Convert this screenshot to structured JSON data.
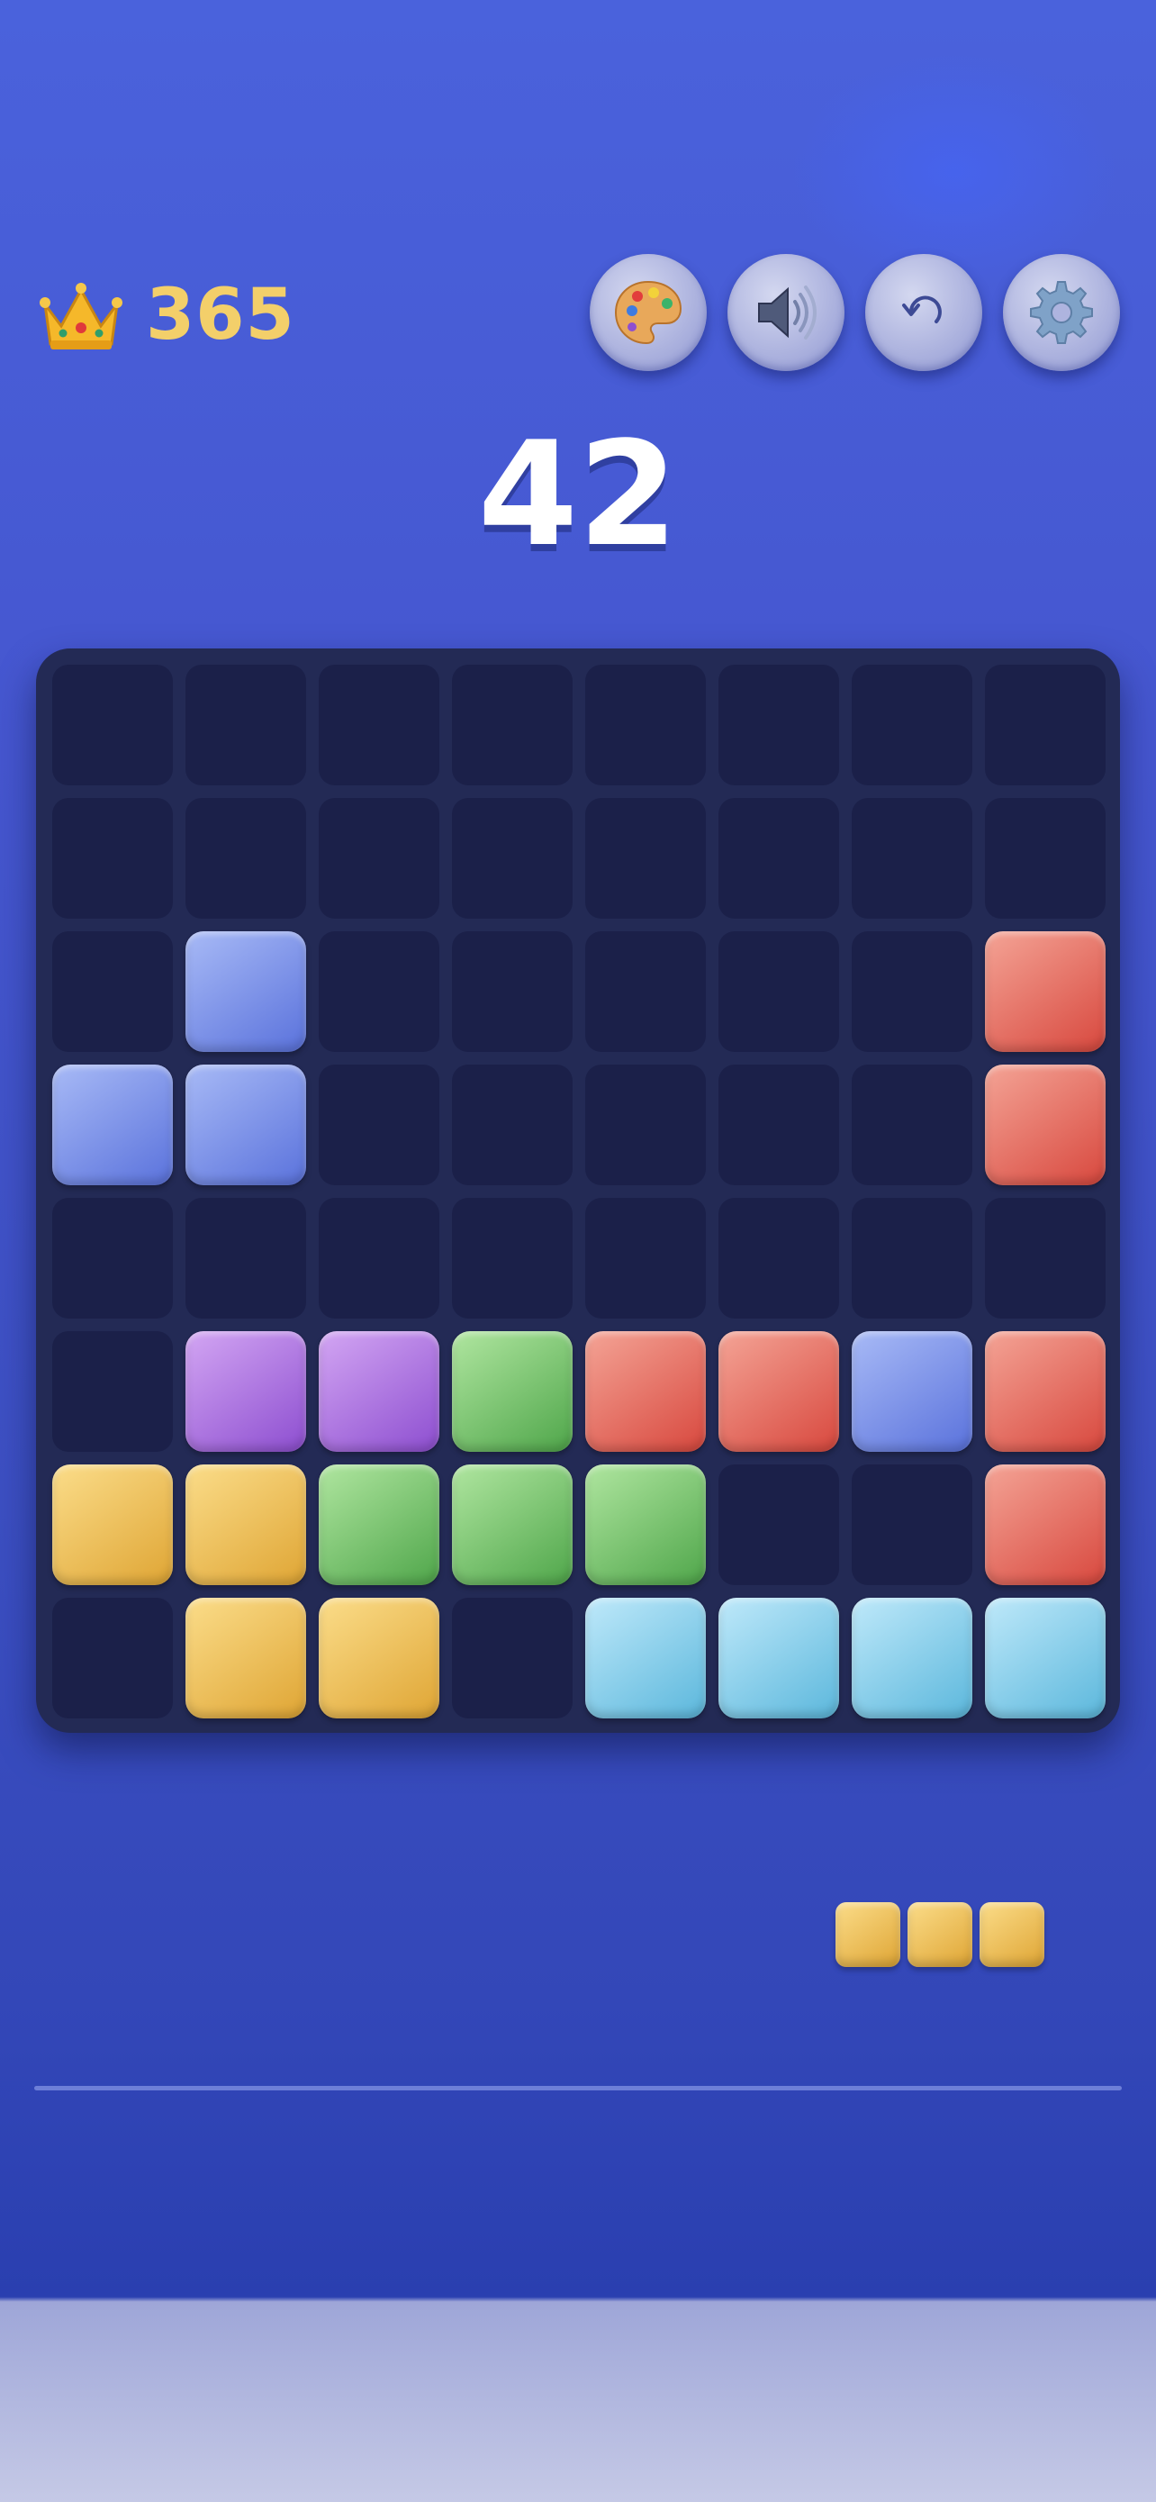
{
  "best_score": {
    "icon": "crown-icon",
    "value": "365"
  },
  "toolbar": [
    {
      "name": "theme-button",
      "icon": "palette-icon"
    },
    {
      "name": "sound-button",
      "icon": "speaker-icon"
    },
    {
      "name": "undo-button",
      "icon": "undo-icon"
    },
    {
      "name": "settings-button",
      "icon": "gear-icon"
    }
  ],
  "score": "42",
  "colors": {
    "blue": [
      "#a8baf6",
      "#5a72dc"
    ],
    "red": [
      "#f4a496",
      "#d8483e"
    ],
    "purple": [
      "#d3a6f3",
      "#8d4ed0"
    ],
    "green": [
      "#b0e6a0",
      "#4fa64a"
    ],
    "yellow": [
      "#fbdd8a",
      "#dfa534"
    ],
    "cyan": [
      "#bfe9fa",
      "#5bb7dc"
    ]
  },
  "board": {
    "rows": 8,
    "cols": 8,
    "grid": [
      [
        null,
        null,
        null,
        null,
        null,
        null,
        null,
        null
      ],
      [
        null,
        null,
        null,
        null,
        null,
        null,
        null,
        null
      ],
      [
        null,
        "blue",
        null,
        null,
        null,
        null,
        null,
        "red"
      ],
      [
        "blue",
        "blue",
        null,
        null,
        null,
        null,
        null,
        "red"
      ],
      [
        null,
        null,
        null,
        null,
        null,
        null,
        null,
        null
      ],
      [
        null,
        "purple",
        "purple",
        "green",
        "red",
        "red",
        "blue",
        "red"
      ],
      [
        "yellow",
        "yellow",
        "green",
        "green",
        "green",
        null,
        null,
        "red"
      ],
      [
        null,
        "yellow",
        "yellow",
        null,
        "cyan",
        "cyan",
        "cyan",
        "cyan"
      ]
    ]
  },
  "next_piece": {
    "color": "yellow",
    "cells": [
      [
        0,
        0
      ],
      [
        0,
        1
      ],
      [
        0,
        2
      ]
    ]
  }
}
